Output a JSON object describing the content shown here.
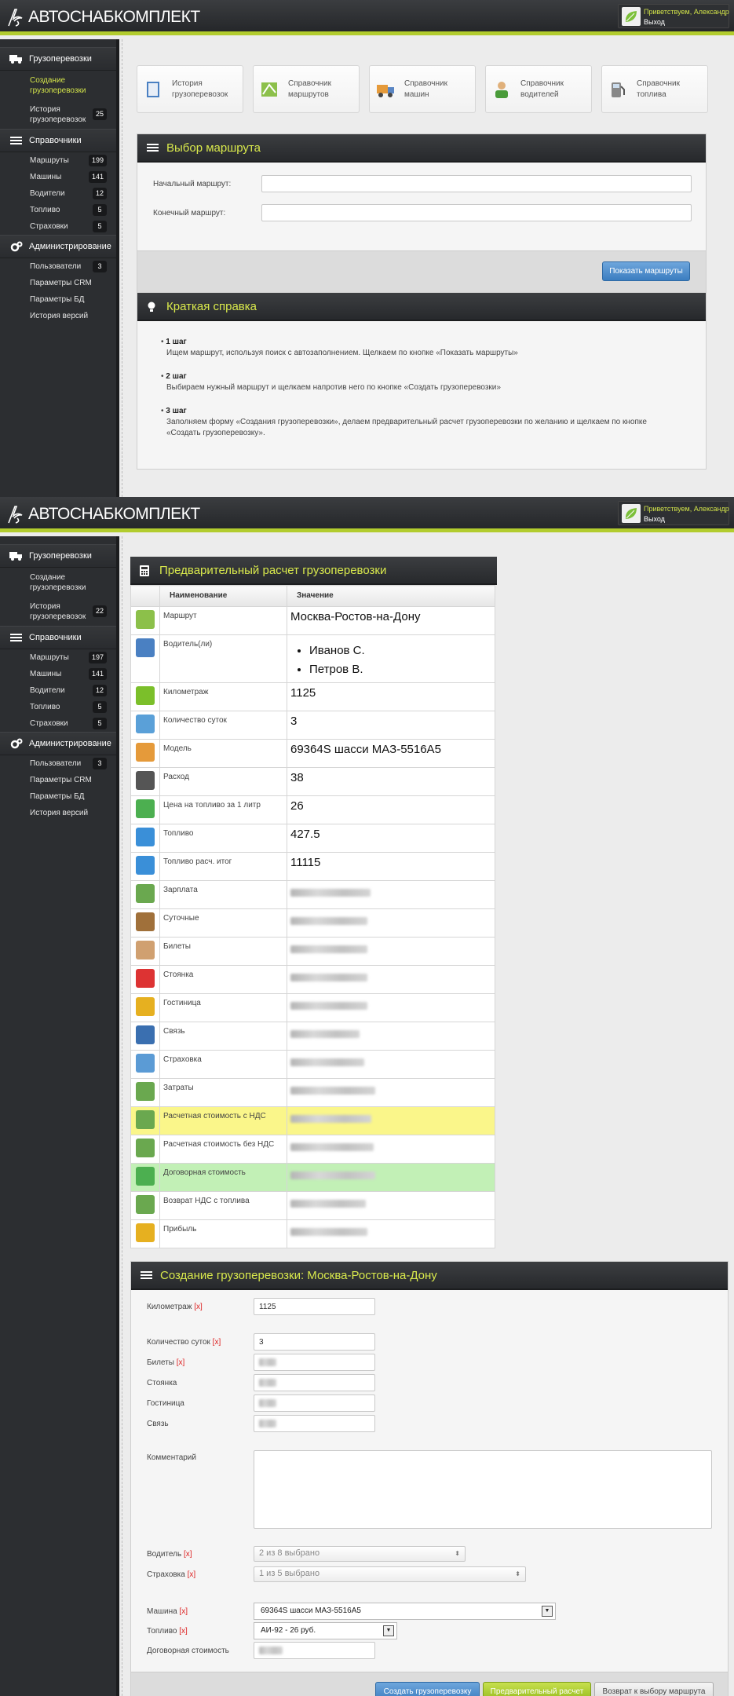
{
  "app": {
    "logo_text": "АВТОСНАБКОМПЛЕКТ",
    "greeting": "Приветствуем, Александр",
    "logout": "Выход"
  },
  "sidebar": {
    "cargo": "Грузоперевозки",
    "create": "Создание грузоперевозки",
    "history": "История грузоперевозок",
    "refs": "Справочники",
    "routes": "Маршруты",
    "cars": "Машины",
    "drivers": "Водители",
    "fuel": "Топливо",
    "insurance": "Страховки",
    "admin": "Администрирование",
    "users": "Пользователи",
    "crm": "Параметры CRM",
    "db": "Параметры БД",
    "versions": "История версий"
  },
  "sidebar_counts_1": {
    "history": "25",
    "routes": "199",
    "cars": "141",
    "drivers": "12",
    "fuel": "5",
    "insurance": "5",
    "users": "3"
  },
  "sidebar_counts_2": {
    "history": "22",
    "routes": "197",
    "cars": "141",
    "drivers": "12",
    "fuel": "5",
    "insurance": "5",
    "users": "3"
  },
  "shortcuts": [
    "История грузоперевозок",
    "Справочник маршрутов",
    "Справочник машин",
    "Справочник водителей",
    "Справочник топлива"
  ],
  "route_select": {
    "title": "Выбор маршрута",
    "start_label": "Начальный маршрут:",
    "end_label": "Конечный маршрут:",
    "start_value": "",
    "end_value": "",
    "show_button": "Показать маршруты"
  },
  "help": {
    "title": "Краткая справка",
    "steps": [
      {
        "title": "1 шаг",
        "text": "Ищем маршрут, используя поиск с автозаполнением. Щелкаем по кнопке «Показать маршруты»"
      },
      {
        "title": "2 шаг",
        "text": "Выбираем нужный маршрут и щелкаем напротив него по кнопке «Создать грузоперевозки»"
      },
      {
        "title": "3 шаг",
        "text": "Заполняем форму «Создания грузоперевозки», делаем предварительный расчет грузоперевозки по желанию и щелкаем по кнопке «Создать грузоперевозку»."
      }
    ]
  },
  "calc": {
    "title": "Предварительный расчет грузоперевозки",
    "col_name": "Наименование",
    "col_value": "Значение",
    "rows": [
      {
        "name": "Маршрут",
        "value": "Москва-Ростов-на-Дону"
      },
      {
        "name": "Водитель(ли)",
        "list": [
          "Иванов С.",
          "Петров В."
        ]
      },
      {
        "name": "Километраж",
        "value": "1125"
      },
      {
        "name": "Количество суток",
        "value": "3"
      },
      {
        "name": "Модель",
        "value": "69364S шасси МАЗ-5516А5"
      },
      {
        "name": "Расход",
        "value": "38"
      },
      {
        "name": "Цена на топливо за 1 литр",
        "value": "26"
      },
      {
        "name": "Топливо",
        "value": "427.5"
      },
      {
        "name": "Топливо расч. итог",
        "value": "11115"
      },
      {
        "name": "Зарплата",
        "value": ""
      },
      {
        "name": "Суточные",
        "value": ""
      },
      {
        "name": "Билеты",
        "value": ""
      },
      {
        "name": "Стоянка",
        "value": ""
      },
      {
        "name": "Гостиница",
        "value": ""
      },
      {
        "name": "Связь",
        "value": ""
      },
      {
        "name": "Страховка",
        "value": ""
      },
      {
        "name": "Затраты",
        "value": ""
      },
      {
        "name": "Расчетная стоимость с НДС",
        "value": ""
      },
      {
        "name": "Расчетная стоимость без НДС",
        "value": ""
      },
      {
        "name": "Договорная стоимость",
        "value": ""
      },
      {
        "name": "Возврат НДС с топлива",
        "value": ""
      },
      {
        "name": "Прибыль",
        "value": ""
      }
    ]
  },
  "create": {
    "title": "Создание грузоперевозки: Москва-Ростов-на-Дону",
    "req": "[x]",
    "km_label": "Километраж",
    "km_value": "1125",
    "days_label": "Количество суток",
    "days_value": "3",
    "tickets_label": "Билеты",
    "parking_label": "Стоянка",
    "hotel_label": "Гостиница",
    "comm_label": "Связь",
    "comment_label": "Комментарий",
    "driver_label": "Водитель",
    "driver_value": "2 из 8 выбрано",
    "insurance_label": "Страховка",
    "insurance_value": "1 из 5 выбрано",
    "car_label": "Машина",
    "car_value": "69364S шасси МАЗ-5516А5",
    "fuel_label": "Топливо",
    "fuel_value": "АИ-92 - 26 руб.",
    "contract_label": "Договорная стоимость",
    "btn_create": "Создать грузоперевозку",
    "btn_calc": "Предварительный расчет",
    "btn_back": "Возврат к выбору маршрута"
  }
}
